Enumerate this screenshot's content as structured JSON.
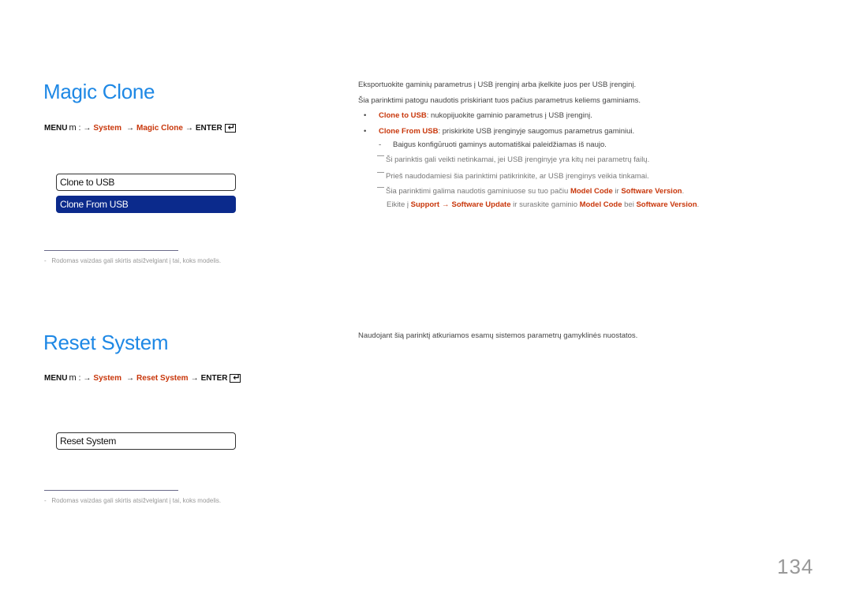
{
  "sections": [
    {
      "title": "Magic Clone",
      "menu_path": {
        "menu_label": "MENU",
        "menu_glyph": "m",
        "separator": ":",
        "arrow": "→",
        "items": [
          "System",
          "Magic Clone"
        ],
        "enter_label": "ENTER"
      },
      "osd_items": [
        {
          "label": "Clone to USB",
          "selected": false
        },
        {
          "label": "Clone From USB",
          "selected": true
        }
      ],
      "footnote": "Rodomas vaizdas gali skirtis atsižvelgiant į tai, koks modelis.",
      "footnote_dash": "-",
      "description": {
        "paragraphs": [
          "Eksportuokite gaminių parametrus į USB įrenginį arba įkelkite juos per USB įrenginį.",
          "Šia parinktimi patogu naudotis priskiriant tuos pačius parametrus keliems gaminiams."
        ],
        "bullet_char": "•",
        "bullets": [
          {
            "term": "Clone to USB",
            "text": ": nukopijuokite gaminio parametrus į USB įrenginį."
          },
          {
            "term": "Clone From USB",
            "text": ": priskirkite USB įrenginyje saugomus parametrus gaminiui."
          }
        ],
        "sub_dash": "-",
        "sub_item": "Baigus konfigūruoti gaminys automatiškai paleidžiamas iš naujo.",
        "notes": [
          "Ši parinktis gali veikti netinkamai, jei USB įrenginyje yra kitų nei parametrų failų.",
          "Prieš naudodamiesi šia parinktimi patikrinkite, ar USB įrenginys veikia tinkamai."
        ],
        "note3": {
          "line1_text": "Šia parinktimi galima naudotis gaminiuose su tuo pačiu ",
          "line1_term1": "Model Code",
          "line1_mid": " ir ",
          "line1_term2": "Software Version",
          "line1_end": ".",
          "line2_start": "Eikite į ",
          "line2_term1": "Support",
          "line2_arrow": "→",
          "line2_term2": "Software Update",
          "line2_mid": " ir suraskite gaminio ",
          "line2_term3": "Model Code",
          "line2_mid2": " bei ",
          "line2_term4": "Software Version",
          "line2_end": "."
        }
      }
    },
    {
      "title": "Reset System",
      "menu_path": {
        "menu_label": "MENU",
        "menu_glyph": "m",
        "separator": ":",
        "arrow": "→",
        "items": [
          "System",
          "Reset System"
        ],
        "enter_label": "ENTER"
      },
      "osd_items": [
        {
          "label": "Reset System",
          "selected": false
        }
      ],
      "footnote": "Rodomas vaizdas gali skirtis atsižvelgiant į tai, koks modelis.",
      "footnote_dash": "-",
      "description": {
        "paragraphs": [
          "Naudojant šią parinktį atkuriamos esamų sistemos parametrų gamyklinės nuostatos."
        ]
      }
    }
  ],
  "page_number": "134",
  "colors": {
    "title": "#1e88e5",
    "highlight": "#c8360a",
    "selected_bg": "#0b2a8c"
  }
}
